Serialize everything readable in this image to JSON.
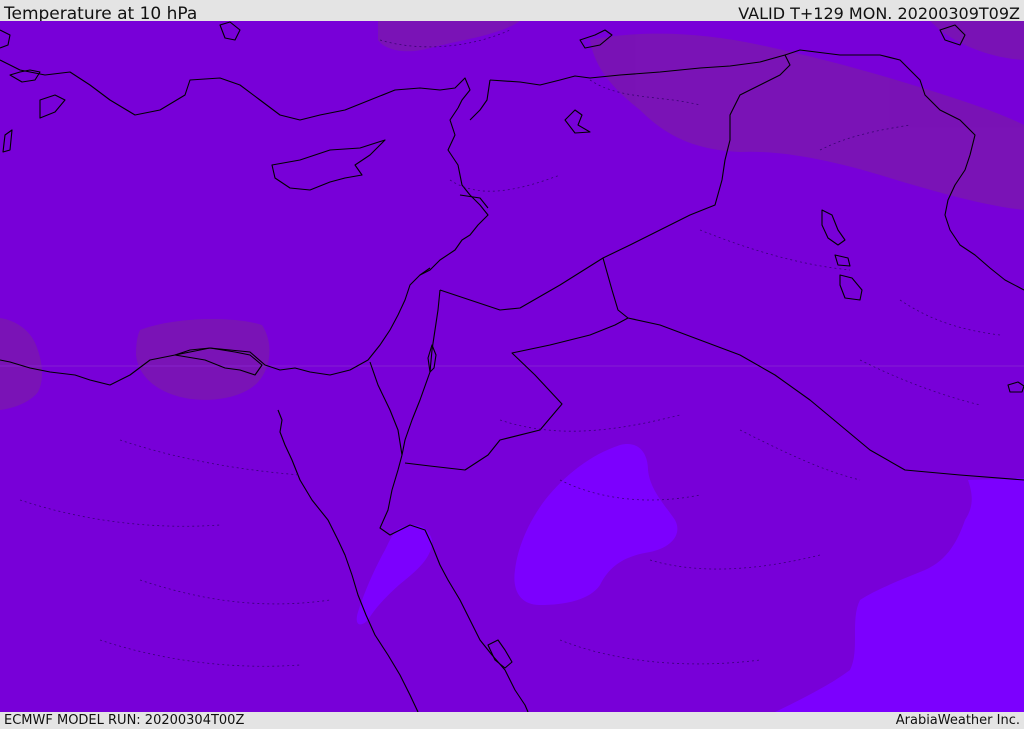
{
  "header": {
    "title": "Temperature at 10 hPa",
    "valid": "VALID T+129 MON. 20200309T09Z"
  },
  "footer": {
    "model_run": "ECMWF MODEL RUN: 20200304T00Z",
    "credit": "ArabiaWeather Inc."
  },
  "colors": {
    "base_fill": "#7800d8",
    "warm_fill": "#7a14b4",
    "cool_fill": "#7c00fe",
    "boundary": "#000000"
  }
}
